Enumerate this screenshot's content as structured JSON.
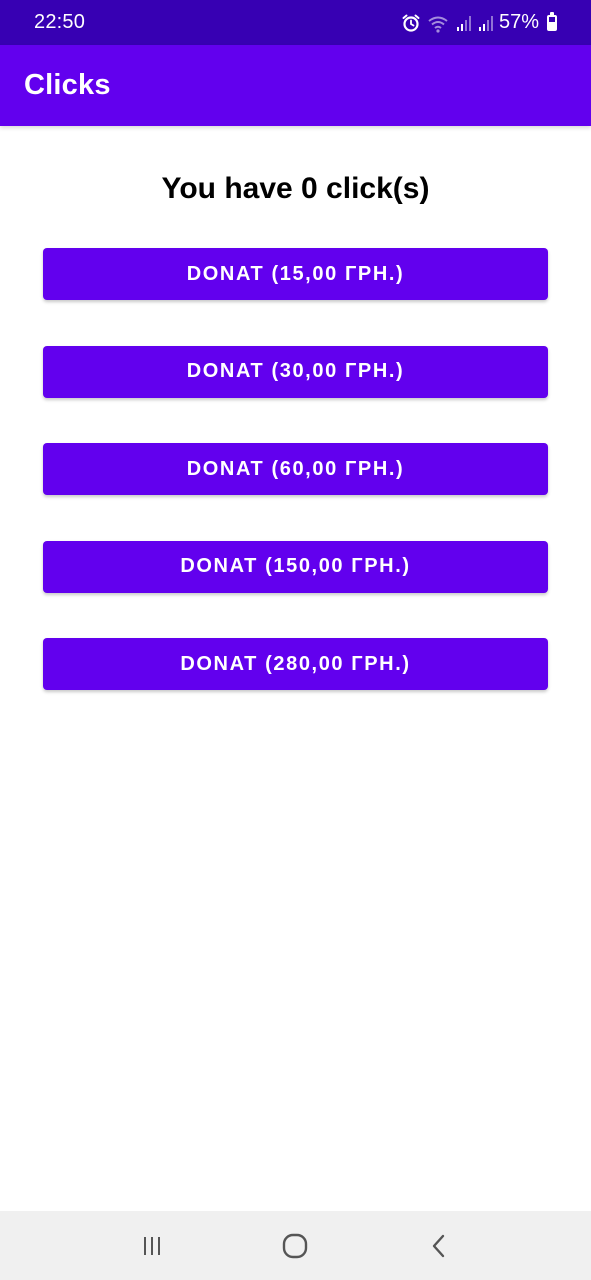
{
  "status_bar": {
    "time": "22:50",
    "battery_percent": "57%",
    "battery_level": 0.57,
    "icons": [
      "alarm-icon",
      "wifi-icon",
      "signal-icon",
      "signal-icon",
      "battery-icon"
    ]
  },
  "app_bar": {
    "title": "Clicks"
  },
  "main": {
    "clicks_label": "You have 0 click(s)",
    "buttons": [
      {
        "label": "DONAT (15,00 ГРН.)"
      },
      {
        "label": "DONAT (30,00 ГРН.)"
      },
      {
        "label": "DONAT (60,00 ГРН.)"
      },
      {
        "label": "DONAT (150,00 ГРН.)"
      },
      {
        "label": "DONAT (280,00 ГРН.)"
      }
    ]
  },
  "nav_bar": {
    "icons": [
      "recent-apps-icon",
      "home-icon",
      "back-icon"
    ]
  },
  "colors": {
    "status_bar": "#3700b3",
    "primary": "#6200ee",
    "background": "#ffffff",
    "nav_bar": "#f0f0f0"
  }
}
